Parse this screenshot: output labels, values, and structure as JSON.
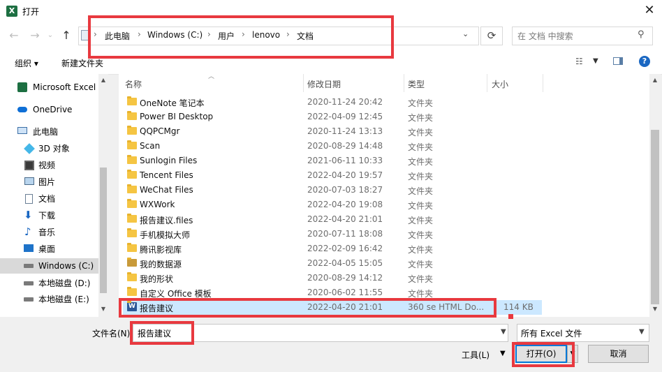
{
  "window": {
    "title": "打开",
    "app_icon_letter": "X",
    "close_glyph": "✕"
  },
  "nav": {
    "back_glyph": "←",
    "forward_glyph": "→",
    "up_glyph": "↑",
    "dropdown_glyph": "⌄",
    "refresh_glyph": "⟳"
  },
  "address": {
    "crumbs": [
      "此电脑",
      "Windows (C:)",
      "用户",
      "lenovo",
      "文档"
    ],
    "separator": "›"
  },
  "search": {
    "placeholder": "在 文档 中搜索"
  },
  "toolbar": {
    "organize": "组织 ▾",
    "new_folder": "新建文件夹"
  },
  "sidebar": {
    "items": [
      {
        "label": "Microsoft Excel",
        "icon": "excel-icon"
      },
      {
        "label": "OneDrive",
        "icon": "cloud-icon"
      },
      {
        "label": "此电脑",
        "icon": "computer-icon"
      },
      {
        "label": "3D 对象",
        "icon": "cube-icon"
      },
      {
        "label": "视频",
        "icon": "video-icon"
      },
      {
        "label": "图片",
        "icon": "picture-icon"
      },
      {
        "label": "文档",
        "icon": "document-icon"
      },
      {
        "label": "下载",
        "icon": "download-icon"
      },
      {
        "label": "音乐",
        "icon": "music-icon"
      },
      {
        "label": "桌面",
        "icon": "desktop-icon"
      },
      {
        "label": "Windows (C:)",
        "icon": "drive-icon"
      },
      {
        "label": "本地磁盘 (D:)",
        "icon": "drive-icon"
      },
      {
        "label": "本地磁盘 (E:)",
        "icon": "drive-icon"
      }
    ]
  },
  "columns": {
    "name": "名称",
    "modified": "修改日期",
    "type": "类型",
    "size": "大小"
  },
  "files": [
    {
      "name": "OneNote 笔记本",
      "modified": "2020-11-24 20:42",
      "type": "文件夹",
      "size": ""
    },
    {
      "name": "Power BI Desktop",
      "modified": "2022-04-09 12:45",
      "type": "文件夹",
      "size": ""
    },
    {
      "name": "QQPCMgr",
      "modified": "2020-11-24 13:13",
      "type": "文件夹",
      "size": ""
    },
    {
      "name": "Scan",
      "modified": "2020-08-29 14:48",
      "type": "文件夹",
      "size": ""
    },
    {
      "name": "Sunlogin Files",
      "modified": "2021-06-11 10:33",
      "type": "文件夹",
      "size": ""
    },
    {
      "name": "Tencent Files",
      "modified": "2022-04-20 19:57",
      "type": "文件夹",
      "size": ""
    },
    {
      "name": "WeChat Files",
      "modified": "2020-07-03 18:27",
      "type": "文件夹",
      "size": ""
    },
    {
      "name": "WXWork",
      "modified": "2022-04-20 19:08",
      "type": "文件夹",
      "size": ""
    },
    {
      "name": "报告建议.files",
      "modified": "2022-04-20 21:01",
      "type": "文件夹",
      "size": ""
    },
    {
      "name": "手机模拟大师",
      "modified": "2020-07-11 18:08",
      "type": "文件夹",
      "size": ""
    },
    {
      "name": "腾讯影视库",
      "modified": "2022-02-09 16:42",
      "type": "文件夹",
      "size": ""
    },
    {
      "name": "我的数据源",
      "modified": "2022-04-05 15:05",
      "type": "文件夹",
      "size": ""
    },
    {
      "name": "我的形状",
      "modified": "2020-08-29 14:12",
      "type": "文件夹",
      "size": ""
    },
    {
      "name": "自定义 Office 模板",
      "modified": "2020-06-02 11:55",
      "type": "文件夹",
      "size": ""
    },
    {
      "name": "报告建议",
      "modified": "2022-04-20 21:01",
      "type": "360 se HTML Do...",
      "size": "114 KB"
    }
  ],
  "bottom": {
    "filename_label": "文件名(N):",
    "filename_value": "报告建议",
    "filetype_value": "所有 Excel 文件",
    "tools_label": "工具(L)",
    "open_label": "打开(O)",
    "cancel_label": "取消"
  },
  "colors": {
    "annotation_red": "#e8393f",
    "selection_blue": "#cce8ff",
    "folder_yellow": "#f5c543"
  }
}
